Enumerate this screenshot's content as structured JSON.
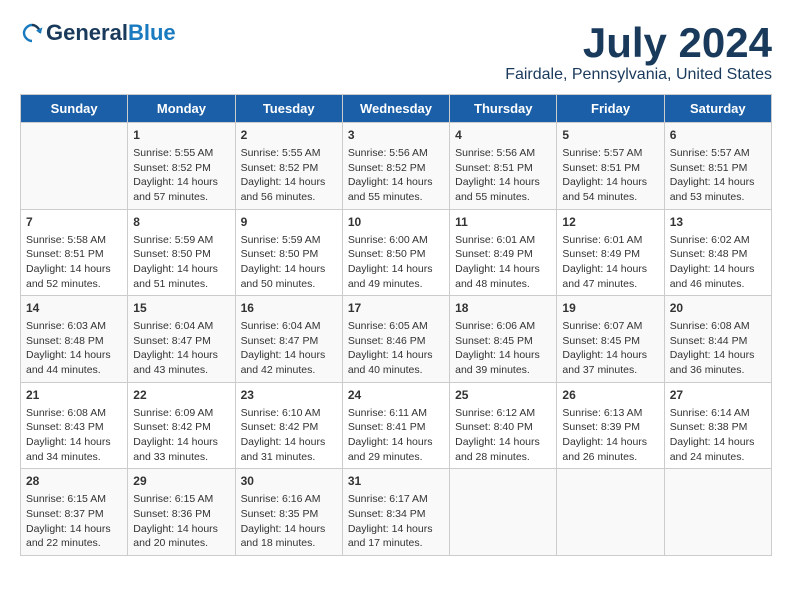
{
  "header": {
    "logo_general": "General",
    "logo_blue": "Blue",
    "month_title": "July 2024",
    "location": "Fairdale, Pennsylvania, United States"
  },
  "days_of_week": [
    "Sunday",
    "Monday",
    "Tuesday",
    "Wednesday",
    "Thursday",
    "Friday",
    "Saturday"
  ],
  "weeks": [
    [
      {
        "day": "",
        "content": ""
      },
      {
        "day": "1",
        "content": "Sunrise: 5:55 AM\nSunset: 8:52 PM\nDaylight: 14 hours\nand 57 minutes."
      },
      {
        "day": "2",
        "content": "Sunrise: 5:55 AM\nSunset: 8:52 PM\nDaylight: 14 hours\nand 56 minutes."
      },
      {
        "day": "3",
        "content": "Sunrise: 5:56 AM\nSunset: 8:52 PM\nDaylight: 14 hours\nand 55 minutes."
      },
      {
        "day": "4",
        "content": "Sunrise: 5:56 AM\nSunset: 8:51 PM\nDaylight: 14 hours\nand 55 minutes."
      },
      {
        "day": "5",
        "content": "Sunrise: 5:57 AM\nSunset: 8:51 PM\nDaylight: 14 hours\nand 54 minutes."
      },
      {
        "day": "6",
        "content": "Sunrise: 5:57 AM\nSunset: 8:51 PM\nDaylight: 14 hours\nand 53 minutes."
      }
    ],
    [
      {
        "day": "7",
        "content": "Sunrise: 5:58 AM\nSunset: 8:51 PM\nDaylight: 14 hours\nand 52 minutes."
      },
      {
        "day": "8",
        "content": "Sunrise: 5:59 AM\nSunset: 8:50 PM\nDaylight: 14 hours\nand 51 minutes."
      },
      {
        "day": "9",
        "content": "Sunrise: 5:59 AM\nSunset: 8:50 PM\nDaylight: 14 hours\nand 50 minutes."
      },
      {
        "day": "10",
        "content": "Sunrise: 6:00 AM\nSunset: 8:50 PM\nDaylight: 14 hours\nand 49 minutes."
      },
      {
        "day": "11",
        "content": "Sunrise: 6:01 AM\nSunset: 8:49 PM\nDaylight: 14 hours\nand 48 minutes."
      },
      {
        "day": "12",
        "content": "Sunrise: 6:01 AM\nSunset: 8:49 PM\nDaylight: 14 hours\nand 47 minutes."
      },
      {
        "day": "13",
        "content": "Sunrise: 6:02 AM\nSunset: 8:48 PM\nDaylight: 14 hours\nand 46 minutes."
      }
    ],
    [
      {
        "day": "14",
        "content": "Sunrise: 6:03 AM\nSunset: 8:48 PM\nDaylight: 14 hours\nand 44 minutes."
      },
      {
        "day": "15",
        "content": "Sunrise: 6:04 AM\nSunset: 8:47 PM\nDaylight: 14 hours\nand 43 minutes."
      },
      {
        "day": "16",
        "content": "Sunrise: 6:04 AM\nSunset: 8:47 PM\nDaylight: 14 hours\nand 42 minutes."
      },
      {
        "day": "17",
        "content": "Sunrise: 6:05 AM\nSunset: 8:46 PM\nDaylight: 14 hours\nand 40 minutes."
      },
      {
        "day": "18",
        "content": "Sunrise: 6:06 AM\nSunset: 8:45 PM\nDaylight: 14 hours\nand 39 minutes."
      },
      {
        "day": "19",
        "content": "Sunrise: 6:07 AM\nSunset: 8:45 PM\nDaylight: 14 hours\nand 37 minutes."
      },
      {
        "day": "20",
        "content": "Sunrise: 6:08 AM\nSunset: 8:44 PM\nDaylight: 14 hours\nand 36 minutes."
      }
    ],
    [
      {
        "day": "21",
        "content": "Sunrise: 6:08 AM\nSunset: 8:43 PM\nDaylight: 14 hours\nand 34 minutes."
      },
      {
        "day": "22",
        "content": "Sunrise: 6:09 AM\nSunset: 8:42 PM\nDaylight: 14 hours\nand 33 minutes."
      },
      {
        "day": "23",
        "content": "Sunrise: 6:10 AM\nSunset: 8:42 PM\nDaylight: 14 hours\nand 31 minutes."
      },
      {
        "day": "24",
        "content": "Sunrise: 6:11 AM\nSunset: 8:41 PM\nDaylight: 14 hours\nand 29 minutes."
      },
      {
        "day": "25",
        "content": "Sunrise: 6:12 AM\nSunset: 8:40 PM\nDaylight: 14 hours\nand 28 minutes."
      },
      {
        "day": "26",
        "content": "Sunrise: 6:13 AM\nSunset: 8:39 PM\nDaylight: 14 hours\nand 26 minutes."
      },
      {
        "day": "27",
        "content": "Sunrise: 6:14 AM\nSunset: 8:38 PM\nDaylight: 14 hours\nand 24 minutes."
      }
    ],
    [
      {
        "day": "28",
        "content": "Sunrise: 6:15 AM\nSunset: 8:37 PM\nDaylight: 14 hours\nand 22 minutes."
      },
      {
        "day": "29",
        "content": "Sunrise: 6:15 AM\nSunset: 8:36 PM\nDaylight: 14 hours\nand 20 minutes."
      },
      {
        "day": "30",
        "content": "Sunrise: 6:16 AM\nSunset: 8:35 PM\nDaylight: 14 hours\nand 18 minutes."
      },
      {
        "day": "31",
        "content": "Sunrise: 6:17 AM\nSunset: 8:34 PM\nDaylight: 14 hours\nand 17 minutes."
      },
      {
        "day": "",
        "content": ""
      },
      {
        "day": "",
        "content": ""
      },
      {
        "day": "",
        "content": ""
      }
    ]
  ]
}
